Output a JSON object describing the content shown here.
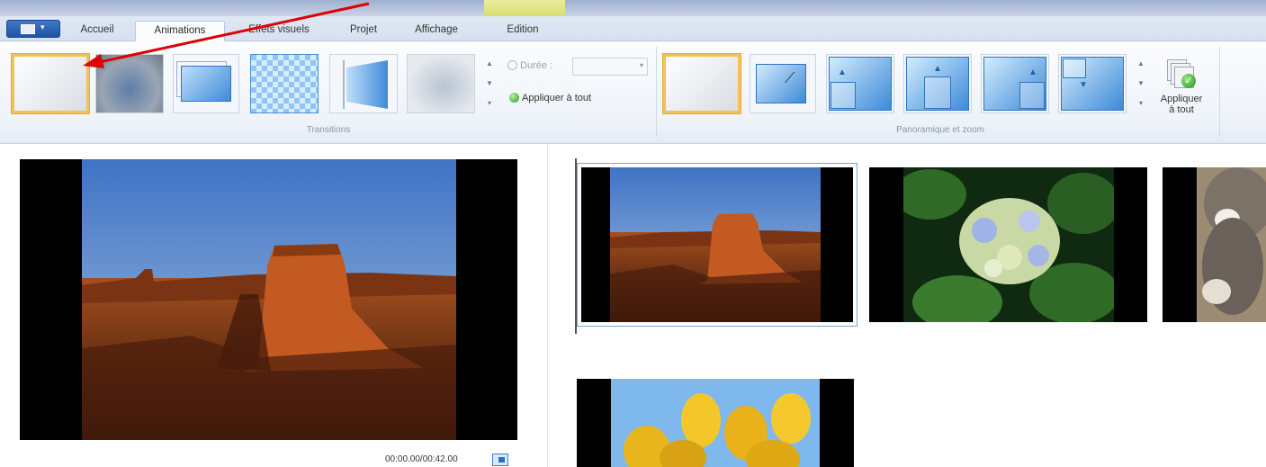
{
  "tabs": [
    {
      "label": "Accueil",
      "active": false
    },
    {
      "label": "Animations",
      "active": true
    },
    {
      "label": "Effets visuels",
      "active": false
    },
    {
      "label": "Projet",
      "active": false
    },
    {
      "label": "Affichage",
      "active": false
    },
    {
      "label": "Edition",
      "active": false
    }
  ],
  "ribbon": {
    "transitions": {
      "group_label": "Transitions",
      "items": [
        "transition-none",
        "transition-blur",
        "transition-slide",
        "transition-checkerboard",
        "transition-door",
        "transition-fade"
      ],
      "selected_index": 0,
      "duration_label": "Durée :",
      "duration_value": "",
      "apply_all_label": "Appliquer à tout"
    },
    "pan_zoom": {
      "group_label": "Panoramique et zoom",
      "items": [
        "pan-none",
        "pan-auto",
        "pan-up-left",
        "pan-up-center",
        "pan-up-right",
        "pan-vertical"
      ],
      "selected_index": 0,
      "apply_all_label_1": "Appliquer",
      "apply_all_label_2": "à tout"
    }
  },
  "preview": {
    "timecode": "00:00.00/00:42.00"
  },
  "storyboard": {
    "clips": [
      "desert-mesa",
      "hydrangea",
      "koala",
      "tulips"
    ],
    "selected_index": 0
  },
  "colors": {
    "ribbon_selection": "#f2c25a",
    "annotation_arrow": "#e00000",
    "accent_blue": "#3f8bd9"
  }
}
